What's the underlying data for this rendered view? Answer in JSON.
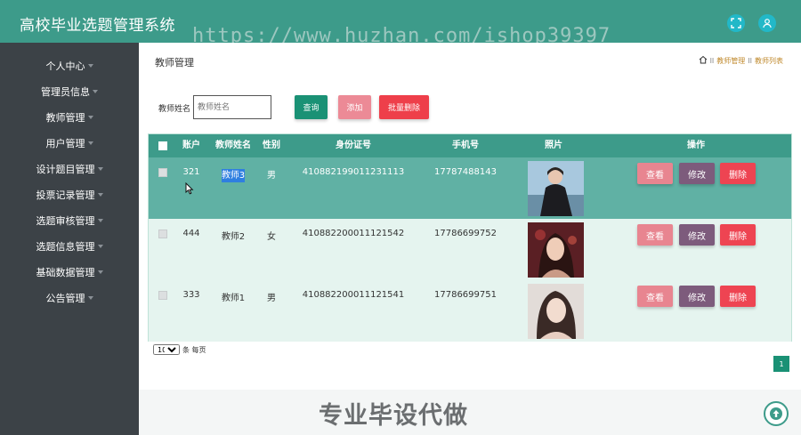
{
  "header": {
    "title": "高校毕业选题管理系统",
    "watermark": "https://www.huzhan.com/ishop39397",
    "icons": [
      "fullscreen-icon",
      "user-icon"
    ]
  },
  "sidebar": {
    "items": [
      {
        "label": "个人中心"
      },
      {
        "label": "管理员信息"
      },
      {
        "label": "教师管理"
      },
      {
        "label": "用户管理"
      },
      {
        "label": "设计题目管理"
      },
      {
        "label": "投票记录管理"
      },
      {
        "label": "选题审核管理"
      },
      {
        "label": "选题信息管理"
      },
      {
        "label": "基础数据管理"
      },
      {
        "label": "公告管理"
      }
    ]
  },
  "main": {
    "page_title": "教师管理",
    "breadcrumb": {
      "sep": "II",
      "items": [
        "教师管理",
        "教师列表"
      ]
    },
    "search": {
      "label": "教师姓名",
      "placeholder": "教师姓名"
    },
    "buttons": {
      "query": "查询",
      "add": "添加",
      "batch_delete": "批量删除"
    },
    "table": {
      "columns": [
        "账户",
        "教师姓名",
        "性别",
        "身份证号",
        "手机号",
        "照片",
        "操作"
      ],
      "rows": [
        {
          "account": "321",
          "name": "教师3",
          "gender": "男",
          "id_no": "410882199011231113",
          "phone": "17787488143"
        },
        {
          "account": "444",
          "name": "教师2",
          "gender": "女",
          "id_no": "410882200011121542",
          "phone": "17786699752"
        },
        {
          "account": "333",
          "name": "教师1",
          "gender": "男",
          "id_no": "410882200011121541",
          "phone": "17786699751"
        }
      ],
      "actions": {
        "view": "查看",
        "edit": "修改",
        "delete": "删除"
      }
    },
    "pager": {
      "page_size": "10",
      "per_page_label": "条 每页",
      "current_page": "1"
    },
    "footer_watermark": "专业毕设代做"
  },
  "colors": {
    "brand": "#3d9b8a",
    "sidebar": "#3c4247",
    "query": "#1a9175",
    "add": "#ec8a96",
    "delete": "#ee3f4a"
  }
}
